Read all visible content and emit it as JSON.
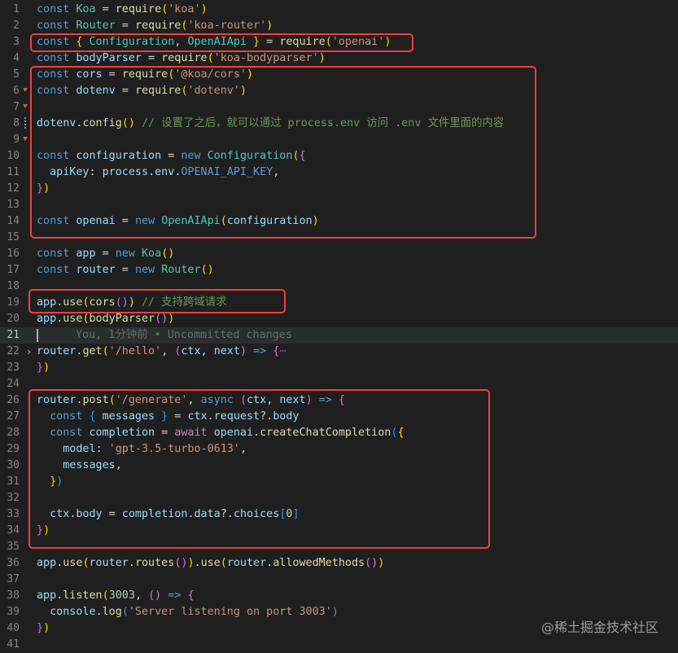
{
  "editor": {
    "active_line": 21,
    "blame": {
      "line": 21,
      "text": "You, 1分钟前 • Uncommitted changes"
    },
    "lines": [
      {
        "n": "1",
        "tokens": [
          [
            "kw",
            "const "
          ],
          [
            "cls",
            "Koa"
          ],
          [
            "pl",
            " = "
          ],
          [
            "fn",
            "require"
          ],
          [
            "b1",
            "("
          ],
          [
            "str",
            "'koa'"
          ],
          [
            "b1",
            ")"
          ]
        ]
      },
      {
        "n": "2",
        "tokens": [
          [
            "kw",
            "const "
          ],
          [
            "cls",
            "Router"
          ],
          [
            "pl",
            " = "
          ],
          [
            "fn",
            "require"
          ],
          [
            "b1",
            "("
          ],
          [
            "str",
            "'koa-router'"
          ],
          [
            "b1",
            ")"
          ]
        ]
      },
      {
        "n": "3",
        "tokens": [
          [
            "kw",
            "const "
          ],
          [
            "b1",
            "{ "
          ],
          [
            "cls",
            "Configuration"
          ],
          [
            "pl",
            ", "
          ],
          [
            "cls",
            "OpenAIApi"
          ],
          [
            "b1",
            " }"
          ],
          [
            "pl",
            " = "
          ],
          [
            "fn",
            "require"
          ],
          [
            "b1",
            "("
          ],
          [
            "str",
            "'openai'"
          ],
          [
            "b1",
            ")"
          ]
        ]
      },
      {
        "n": "4",
        "tokens": [
          [
            "kw",
            "const "
          ],
          [
            "var",
            "bodyParser"
          ],
          [
            "pl",
            " = "
          ],
          [
            "fn",
            "require"
          ],
          [
            "b1",
            "("
          ],
          [
            "str",
            "'koa-bodyparser'"
          ],
          [
            "b1",
            ")"
          ]
        ]
      },
      {
        "n": "5",
        "tokens": [
          [
            "kw",
            "const "
          ],
          [
            "var",
            "cors"
          ],
          [
            "pl",
            " = "
          ],
          [
            "fn",
            "require"
          ],
          [
            "b1",
            "("
          ],
          [
            "str",
            "'@koa/cors'"
          ],
          [
            "b1",
            ")"
          ]
        ]
      },
      {
        "n": "6",
        "tokens": [
          [
            "kw",
            "const "
          ],
          [
            "var",
            "dotenv"
          ],
          [
            "pl",
            " = "
          ],
          [
            "fn",
            "require"
          ],
          [
            "b1",
            "("
          ],
          [
            "str",
            "'dotenv'"
          ],
          [
            "b1",
            ")"
          ]
        ]
      },
      {
        "n": "7",
        "tokens": []
      },
      {
        "n": "8",
        "tokens": [
          [
            "var",
            "dotenv"
          ],
          [
            "pl",
            "."
          ],
          [
            "fn",
            "config"
          ],
          [
            "b1",
            "()"
          ],
          [
            "pl",
            " "
          ],
          [
            "cmt",
            "// 设置了之后，就可以通过 process.env 访问 .env 文件里面的内容"
          ]
        ]
      },
      {
        "n": "9",
        "tokens": []
      },
      {
        "n": "10",
        "tokens": [
          [
            "kw",
            "const "
          ],
          [
            "var",
            "configuration"
          ],
          [
            "pl",
            " = "
          ],
          [
            "kw",
            "new "
          ],
          [
            "cls",
            "Configuration"
          ],
          [
            "b1",
            "("
          ],
          [
            "b2",
            "{"
          ]
        ]
      },
      {
        "n": "11",
        "tokens": [
          [
            "pl",
            "  "
          ],
          [
            "var",
            "apiKey"
          ],
          [
            "pl",
            ": "
          ],
          [
            "var",
            "process"
          ],
          [
            "pl",
            "."
          ],
          [
            "var",
            "env"
          ],
          [
            "pl",
            "."
          ],
          [
            "kw",
            "OPENAI_API_KEY"
          ],
          [
            "pl",
            ","
          ]
        ]
      },
      {
        "n": "12",
        "tokens": [
          [
            "b2",
            "}"
          ],
          [
            "b1",
            ")"
          ]
        ]
      },
      {
        "n": "13",
        "tokens": []
      },
      {
        "n": "14",
        "tokens": [
          [
            "kw",
            "const "
          ],
          [
            "var",
            "openai"
          ],
          [
            "pl",
            " = "
          ],
          [
            "kw",
            "new "
          ],
          [
            "cls",
            "OpenAIApi"
          ],
          [
            "b1",
            "("
          ],
          [
            "var",
            "configuration"
          ],
          [
            "b1",
            ")"
          ]
        ]
      },
      {
        "n": "15",
        "tokens": []
      },
      {
        "n": "16",
        "tokens": [
          [
            "kw",
            "const "
          ],
          [
            "var",
            "app"
          ],
          [
            "pl",
            " = "
          ],
          [
            "kw",
            "new "
          ],
          [
            "cls",
            "Koa"
          ],
          [
            "b1",
            "()"
          ]
        ]
      },
      {
        "n": "17",
        "tokens": [
          [
            "kw",
            "const "
          ],
          [
            "var",
            "router"
          ],
          [
            "pl",
            " = "
          ],
          [
            "kw",
            "new "
          ],
          [
            "cls",
            "Router"
          ],
          [
            "b1",
            "()"
          ]
        ]
      },
      {
        "n": "18",
        "tokens": []
      },
      {
        "n": "19",
        "tokens": [
          [
            "var",
            "app"
          ],
          [
            "pl",
            "."
          ],
          [
            "fn",
            "use"
          ],
          [
            "b1",
            "("
          ],
          [
            "fn",
            "cors"
          ],
          [
            "b2",
            "()"
          ],
          [
            "b1",
            ")"
          ],
          [
            "pl",
            " "
          ],
          [
            "cmt",
            "// 支持跨域请求"
          ]
        ]
      },
      {
        "n": "20",
        "tokens": [
          [
            "var",
            "app"
          ],
          [
            "pl",
            "."
          ],
          [
            "fn",
            "use"
          ],
          [
            "b1",
            "("
          ],
          [
            "fn",
            "bodyParser"
          ],
          [
            "b2",
            "()"
          ],
          [
            "b1",
            ")"
          ]
        ]
      },
      {
        "n": "21",
        "tokens": []
      },
      {
        "n": "22",
        "tokens": [
          [
            "var",
            "router"
          ],
          [
            "pl",
            "."
          ],
          [
            "fn",
            "get"
          ],
          [
            "b1",
            "("
          ],
          [
            "str",
            "'/hello'"
          ],
          [
            "pl",
            ", "
          ],
          [
            "b2",
            "("
          ],
          [
            "var",
            "ctx"
          ],
          [
            "pl",
            ", "
          ],
          [
            "var",
            "next"
          ],
          [
            "b2",
            ")"
          ],
          [
            "pl",
            " "
          ],
          [
            "kw",
            "=>"
          ],
          [
            "pl",
            " "
          ],
          [
            "b2",
            "{"
          ],
          [
            "ghost",
            "⋯"
          ]
        ]
      },
      {
        "n": "23",
        "tokens": [
          [
            "b2",
            "}"
          ],
          [
            "b1",
            ")"
          ]
        ]
      },
      {
        "n": "24",
        "tokens": []
      },
      {
        "n": "26",
        "tokens": [
          [
            "var",
            "router"
          ],
          [
            "pl",
            "."
          ],
          [
            "fn",
            "post"
          ],
          [
            "b1",
            "("
          ],
          [
            "str",
            "'/generate'"
          ],
          [
            "pl",
            ", "
          ],
          [
            "kw",
            "async "
          ],
          [
            "b2",
            "("
          ],
          [
            "var",
            "ctx"
          ],
          [
            "pl",
            ", "
          ],
          [
            "var",
            "next"
          ],
          [
            "b2",
            ")"
          ],
          [
            "pl",
            " "
          ],
          [
            "kw",
            "=>"
          ],
          [
            "pl",
            " "
          ],
          [
            "b2",
            "{"
          ]
        ]
      },
      {
        "n": "27",
        "tokens": [
          [
            "pl",
            "  "
          ],
          [
            "kw",
            "const "
          ],
          [
            "b3",
            "{ "
          ],
          [
            "var",
            "messages"
          ],
          [
            "b3",
            " }"
          ],
          [
            "pl",
            " = "
          ],
          [
            "var",
            "ctx"
          ],
          [
            "pl",
            "."
          ],
          [
            "var",
            "request"
          ],
          [
            "pl",
            "?."
          ],
          [
            "var",
            "body"
          ]
        ]
      },
      {
        "n": "28",
        "tokens": [
          [
            "pl",
            "  "
          ],
          [
            "kw",
            "const "
          ],
          [
            "var",
            "completion"
          ],
          [
            "pl",
            " = "
          ],
          [
            "ctrl",
            "await "
          ],
          [
            "var",
            "openai"
          ],
          [
            "pl",
            "."
          ],
          [
            "fn",
            "createChatCompletion"
          ],
          [
            "b3",
            "("
          ],
          [
            "b1",
            "{"
          ]
        ]
      },
      {
        "n": "29",
        "tokens": [
          [
            "pl",
            "    "
          ],
          [
            "var",
            "model"
          ],
          [
            "pl",
            ": "
          ],
          [
            "str",
            "'gpt-3.5-turbo-0613'"
          ],
          [
            "pl",
            ","
          ]
        ]
      },
      {
        "n": "30",
        "tokens": [
          [
            "pl",
            "    "
          ],
          [
            "var",
            "messages"
          ],
          [
            "pl",
            ","
          ]
        ]
      },
      {
        "n": "31",
        "tokens": [
          [
            "pl",
            "  "
          ],
          [
            "b1",
            "}"
          ],
          [
            "b3",
            ")"
          ]
        ]
      },
      {
        "n": "32",
        "tokens": []
      },
      {
        "n": "33",
        "tokens": [
          [
            "pl",
            "  "
          ],
          [
            "var",
            "ctx"
          ],
          [
            "pl",
            "."
          ],
          [
            "var",
            "body"
          ],
          [
            "pl",
            " = "
          ],
          [
            "var",
            "completion"
          ],
          [
            "pl",
            "."
          ],
          [
            "var",
            "data"
          ],
          [
            "pl",
            "?."
          ],
          [
            "var",
            "choices"
          ],
          [
            "b3",
            "["
          ],
          [
            "num",
            "0"
          ],
          [
            "b3",
            "]"
          ]
        ]
      },
      {
        "n": "34",
        "tokens": [
          [
            "b2",
            "}"
          ],
          [
            "b1",
            ")"
          ]
        ]
      },
      {
        "n": "35",
        "tokens": []
      },
      {
        "n": "36",
        "tokens": [
          [
            "var",
            "app"
          ],
          [
            "pl",
            "."
          ],
          [
            "fn",
            "use"
          ],
          [
            "b1",
            "("
          ],
          [
            "var",
            "router"
          ],
          [
            "pl",
            "."
          ],
          [
            "fn",
            "routes"
          ],
          [
            "b2",
            "()"
          ],
          [
            "b1",
            ")"
          ],
          [
            "pl",
            "."
          ],
          [
            "fn",
            "use"
          ],
          [
            "b1",
            "("
          ],
          [
            "var",
            "router"
          ],
          [
            "pl",
            "."
          ],
          [
            "fn",
            "allowedMethods"
          ],
          [
            "b2",
            "()"
          ],
          [
            "b1",
            ")"
          ]
        ]
      },
      {
        "n": "37",
        "tokens": []
      },
      {
        "n": "38",
        "tokens": [
          [
            "var",
            "app"
          ],
          [
            "pl",
            "."
          ],
          [
            "fn",
            "listen"
          ],
          [
            "b1",
            "("
          ],
          [
            "num",
            "3003"
          ],
          [
            "pl",
            ", "
          ],
          [
            "b2",
            "()"
          ],
          [
            "pl",
            " "
          ],
          [
            "kw",
            "=>"
          ],
          [
            "pl",
            " "
          ],
          [
            "b2",
            "{"
          ]
        ]
      },
      {
        "n": "39",
        "tokens": [
          [
            "pl",
            "  "
          ],
          [
            "var",
            "console"
          ],
          [
            "pl",
            "."
          ],
          [
            "fn",
            "log"
          ],
          [
            "b3",
            "("
          ],
          [
            "str",
            "'Server listening on port 3003'"
          ],
          [
            "b3",
            ")"
          ]
        ]
      },
      {
        "n": "40",
        "tokens": [
          [
            "b2",
            "}"
          ],
          [
            "b1",
            ")"
          ]
        ]
      },
      {
        "n": "41",
        "tokens": []
      }
    ]
  },
  "watermark": "@稀土掘金技术社区"
}
